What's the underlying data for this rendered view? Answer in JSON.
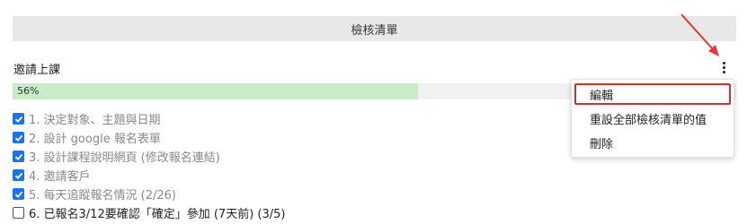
{
  "header": {
    "title": "檢核清單"
  },
  "checklist": {
    "title": "邀請上課",
    "progress_label": "56%",
    "progress_fraction": 0.56,
    "items": [
      {
        "label": "1. 決定對象、主題與日期",
        "checked": true
      },
      {
        "label": "2. 設計 google 報名表單",
        "checked": true
      },
      {
        "label": "3. 設計課程說明網頁 (修改報名連結)",
        "checked": true
      },
      {
        "label": "4. 邀請客戶",
        "checked": true
      },
      {
        "label": "5. 每天追蹤報名情況 (2/26)",
        "checked": true
      },
      {
        "label": "6. 已報名3/12要確認「確定」參加 (7天前) (3/5)",
        "checked": false
      }
    ]
  },
  "menu": {
    "items": [
      {
        "label": "編輯"
      },
      {
        "label": "重設全部檢核清單的值"
      },
      {
        "label": "刪除"
      }
    ]
  },
  "colors": {
    "checkbox": "#1a73e8",
    "progress_fill": "#c8ebc8",
    "highlight": "#d32f2f"
  },
  "icons": {
    "more": "more-vertical-icon",
    "check": "checkmark-icon",
    "arrow": "annotation-arrow-icon"
  }
}
